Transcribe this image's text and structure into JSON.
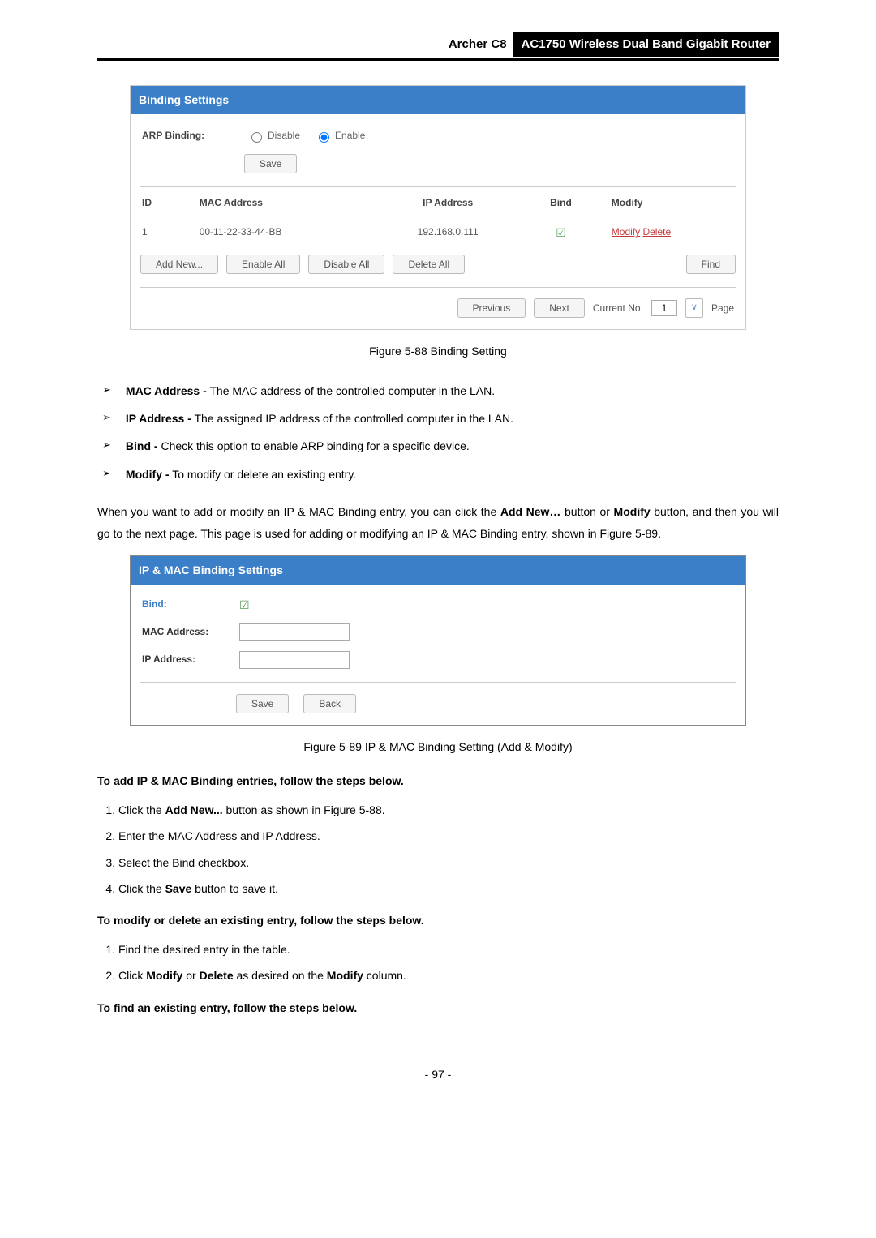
{
  "header": {
    "model": "Archer C8",
    "product": "AC1750 Wireless Dual Band Gigabit Router"
  },
  "panel1": {
    "title": "Binding Settings",
    "arp_label": "ARP Binding:",
    "disable": "Disable",
    "enable": "Enable",
    "save": "Save",
    "cols": {
      "id": "ID",
      "mac": "MAC Address",
      "ip": "IP Address",
      "bind": "Bind",
      "modify": "Modify"
    },
    "row": {
      "id": "1",
      "mac": "00-11-22-33-44-BB",
      "ip": "192.168.0.111",
      "check": "☑",
      "modify": "Modify",
      "delete": "Delete"
    },
    "btns": {
      "addnew": "Add New...",
      "enableall": "Enable All",
      "disableall": "Disable All",
      "deleteall": "Delete All",
      "find": "Find"
    },
    "pager": {
      "prev": "Previous",
      "next": "Next",
      "curno": "Current No.",
      "val": "1",
      "page": "Page"
    }
  },
  "fig88": "Figure 5-88 Binding Setting",
  "bullets": [
    {
      "bold": "MAC Address -",
      "text": " The MAC address of the controlled computer in the LAN."
    },
    {
      "bold": "IP Address -",
      "text": " The assigned IP address of the controlled computer in the LAN."
    },
    {
      "bold": "Bind -",
      "text": " Check this option to enable ARP binding for a specific device."
    },
    {
      "bold": "Modify -",
      "text": " To modify or delete an existing entry."
    }
  ],
  "para1_a": "When you want to add or modify an IP & MAC Binding entry, you can click the ",
  "para1_b": "Add New…",
  "para1_c": " button or ",
  "para1_d": "Modify",
  "para1_e": " button, and then you will go to the next page. This page is used for adding or modifying an IP & MAC Binding entry, shown in Figure 5-89.",
  "panel2": {
    "title": "IP & MAC Binding Settings",
    "bind": "Bind:",
    "mac": "MAC Address:",
    "ip": "IP Address:",
    "check": "☑",
    "save": "Save",
    "back": "Back"
  },
  "fig89": "Figure 5-89 IP & MAC Binding Setting (Add & Modify)",
  "add_head": "To add IP & MAC Binding entries, follow the steps below.",
  "add_steps": {
    "s1a": "Click the ",
    "s1b": "Add New...",
    "s1c": " button as shown in Figure 5-88.",
    "s2": "Enter the MAC Address and IP Address.",
    "s3": "Select the Bind checkbox.",
    "s4a": "Click the ",
    "s4b": "Save",
    "s4c": " button to save it."
  },
  "mod_head": "To modify or delete an existing entry, follow the steps below.",
  "mod_steps": {
    "s1": "Find the desired entry in the table.",
    "s2a": "Click ",
    "s2b": "Modify",
    "s2c": " or ",
    "s2d": "Delete",
    "s2e": " as desired on the ",
    "s2f": "Modify",
    "s2g": " column."
  },
  "find_head": "To find an existing entry, follow the steps below.",
  "pagenum": "- 97 -"
}
